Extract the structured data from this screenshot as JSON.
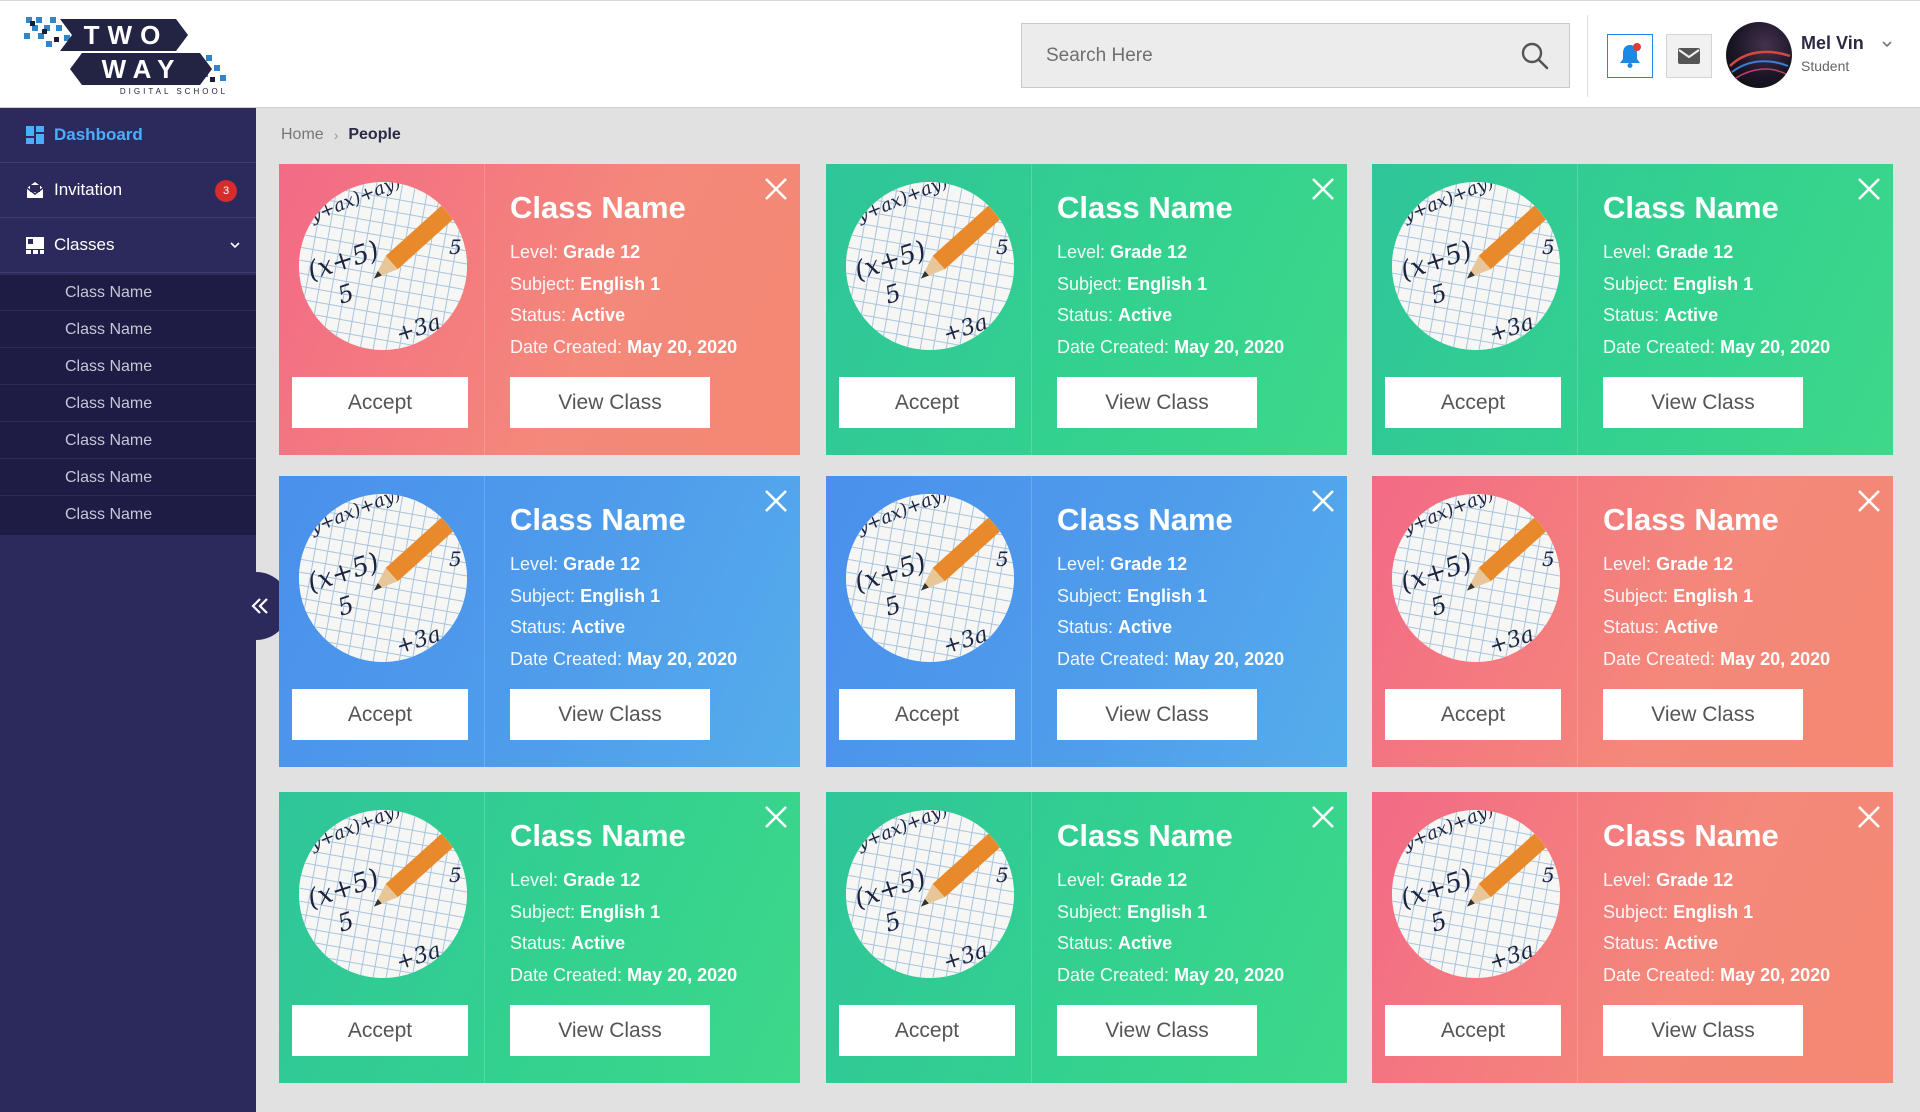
{
  "header": {
    "logo_text_line1": "TWO",
    "logo_text_line2": "WAY",
    "logo_tagline": "DIGITAL SCHOOL",
    "search_placeholder": "Search Here",
    "user_name": "Mel Vin",
    "user_role": "Student"
  },
  "sidebar": {
    "items": [
      {
        "label": "Dashboard",
        "icon": "dashboard-icon"
      },
      {
        "label": "Invitation",
        "icon": "invitation-icon",
        "badge": "3"
      },
      {
        "label": "Classes",
        "icon": "classes-icon"
      }
    ],
    "subitems": [
      "Class Name",
      "Class Name",
      "Class Name",
      "Class Name",
      "Class Name",
      "Class Name",
      "Class Name"
    ]
  },
  "breadcrumb": {
    "home": "Home",
    "current": "People"
  },
  "colors": {
    "red": "#f36a86",
    "green": "#2fc59a",
    "blue": "#4a90ec",
    "sidebar": "#2c2a5c",
    "accent": "#1e88e5"
  },
  "card_labels": {
    "level_label": "Level:",
    "subject_label": "Subject:",
    "status_label": "Status:",
    "date_label": "Date Created:",
    "accept": "Accept",
    "view": "View Class"
  },
  "cards": [
    {
      "color": "red",
      "title": "Class Name",
      "level": "Grade 12",
      "subject": "English 1",
      "status": "Active",
      "date": "May 20, 2020"
    },
    {
      "color": "green",
      "title": "Class Name",
      "level": "Grade 12",
      "subject": "English 1",
      "status": "Active",
      "date": "May 20, 2020"
    },
    {
      "color": "green",
      "title": "Class Name",
      "level": "Grade 12",
      "subject": "English 1",
      "status": "Active",
      "date": "May 20, 2020"
    },
    {
      "color": "blue",
      "title": "Class Name",
      "level": "Grade 12",
      "subject": "English 1",
      "status": "Active",
      "date": "May 20, 2020"
    },
    {
      "color": "blue",
      "title": "Class Name",
      "level": "Grade 12",
      "subject": "English 1",
      "status": "Active",
      "date": "May 20, 2020"
    },
    {
      "color": "red",
      "title": "Class Name",
      "level": "Grade 12",
      "subject": "English 1",
      "status": "Active",
      "date": "May 20, 2020"
    },
    {
      "color": "green",
      "title": "Class Name",
      "level": "Grade 12",
      "subject": "English 1",
      "status": "Active",
      "date": "May 20, 2020"
    },
    {
      "color": "green",
      "title": "Class Name",
      "level": "Grade 12",
      "subject": "English 1",
      "status": "Active",
      "date": "May 20, 2020"
    },
    {
      "color": "red",
      "title": "Class Name",
      "level": "Grade 12",
      "subject": "English 1",
      "status": "Active",
      "date": "May 20, 2020"
    }
  ]
}
